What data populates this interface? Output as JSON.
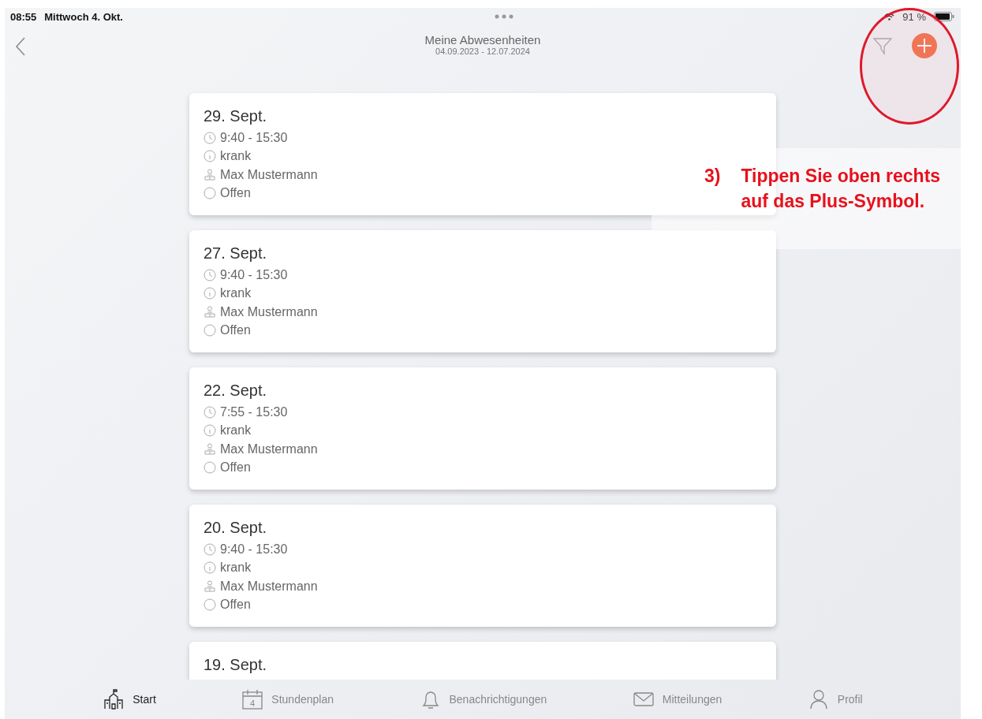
{
  "status_bar": {
    "time": "08:55",
    "date": "Mittwoch 4. Okt.",
    "battery": "91 %"
  },
  "header": {
    "title": "Meine Abwesenheiten",
    "subtitle": "04.09.2023 - 12.07.2024"
  },
  "absences": [
    {
      "date": "29. Sept.",
      "time": "9:40 - 15:30",
      "reason": "krank",
      "person": "Max Mustermann",
      "status": "Offen"
    },
    {
      "date": "27. Sept.",
      "time": "9:40 - 15:30",
      "reason": "krank",
      "person": "Max Mustermann",
      "status": "Offen"
    },
    {
      "date": "22. Sept.",
      "time": "7:55 - 15:30",
      "reason": "krank",
      "person": "Max Mustermann",
      "status": "Offen"
    },
    {
      "date": "20. Sept.",
      "time": "9:40 - 15:30",
      "reason": "krank",
      "person": "Max Mustermann",
      "status": "Offen"
    },
    {
      "date": "19. Sept."
    }
  ],
  "tabs": [
    {
      "kind": "start",
      "label": "Start",
      "selected": true
    },
    {
      "kind": "calendar",
      "label": "Stundenplan",
      "icon_text": "4",
      "selected": false
    },
    {
      "kind": "bell",
      "label": "Benachrichtigungen",
      "selected": false
    },
    {
      "kind": "mail",
      "label": "Mitteilungen",
      "selected": false
    },
    {
      "kind": "person",
      "label": "Profil",
      "selected": false
    }
  ],
  "annotation": {
    "step": "3)",
    "lines": [
      "Tippen Sie oben rechts",
      "auf das Plus-Symbol."
    ]
  }
}
